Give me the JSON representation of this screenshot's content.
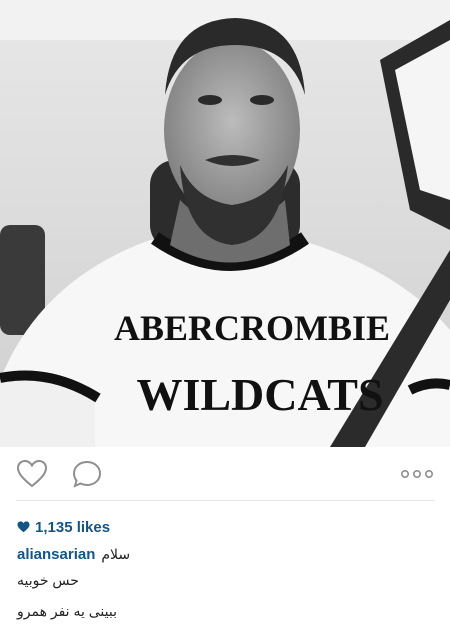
{
  "post": {
    "photo": {
      "shirt_line1": "ABERCROMBIE",
      "shirt_line2": "WILDCATS"
    },
    "actions": {
      "like_icon": "heart-outline-icon",
      "comment_icon": "comment-bubble-icon",
      "more_icon": "more-dots-icon"
    },
    "likes": {
      "icon": "heart-filled-icon",
      "text": "1,135 likes"
    },
    "caption": {
      "username": "aliansarian",
      "lines": [
        "سلام",
        "حس خوبیه",
        "ببینی یه نفر همرو"
      ]
    }
  },
  "colors": {
    "link": "#125688",
    "text": "#222222",
    "icon_stroke": "#8e8e8e",
    "divider": "#e6e6e6"
  }
}
